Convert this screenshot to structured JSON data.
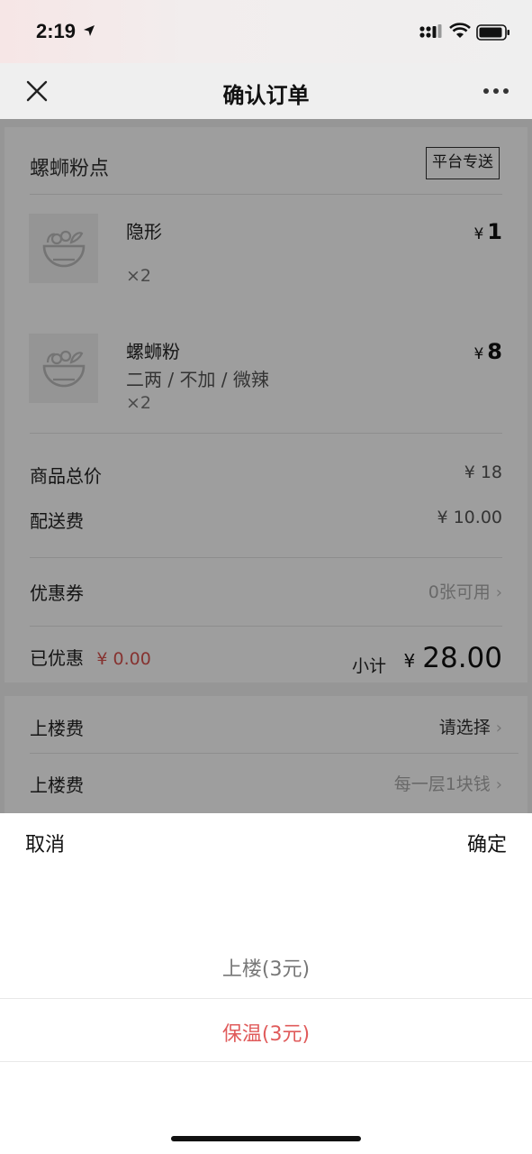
{
  "status_bar": {
    "time": "2:19"
  },
  "nav": {
    "title": "确认订单"
  },
  "shop": {
    "name": "螺蛳粉点",
    "delivery_tag": "平台专送"
  },
  "items": [
    {
      "name": "隐形",
      "spec": "",
      "qty": "×2",
      "currency": "¥",
      "price": "1"
    },
    {
      "name": "螺蛳粉",
      "spec": "二两 / 不加 / 微辣",
      "qty": "×2",
      "currency": "¥",
      "price": "8"
    }
  ],
  "summary": {
    "goods_total_label": "商品总价",
    "goods_total_value": "¥ 18",
    "delivery_fee_label": "配送费",
    "delivery_fee_value": "¥ 10.00",
    "coupon_label": "优惠券",
    "coupon_value": "0张可用",
    "discount_label": "已优惠",
    "discount_value": "¥ 0.00",
    "subtotal_label": "小计",
    "subtotal_currency": "¥",
    "subtotal_amount": "28.00"
  },
  "extras": [
    {
      "label": "上楼费",
      "value": "请选择"
    },
    {
      "label": "上楼费",
      "value": "每一层1块钱"
    }
  ],
  "picker": {
    "cancel": "取消",
    "confirm": "确定",
    "options": [
      "上楼(3元)",
      "保温(3元)"
    ],
    "selected_index": 1
  },
  "colors": {
    "accent_red": "#d9534f",
    "selected_option": "#e05b5b",
    "unselected_option": "#777777"
  }
}
